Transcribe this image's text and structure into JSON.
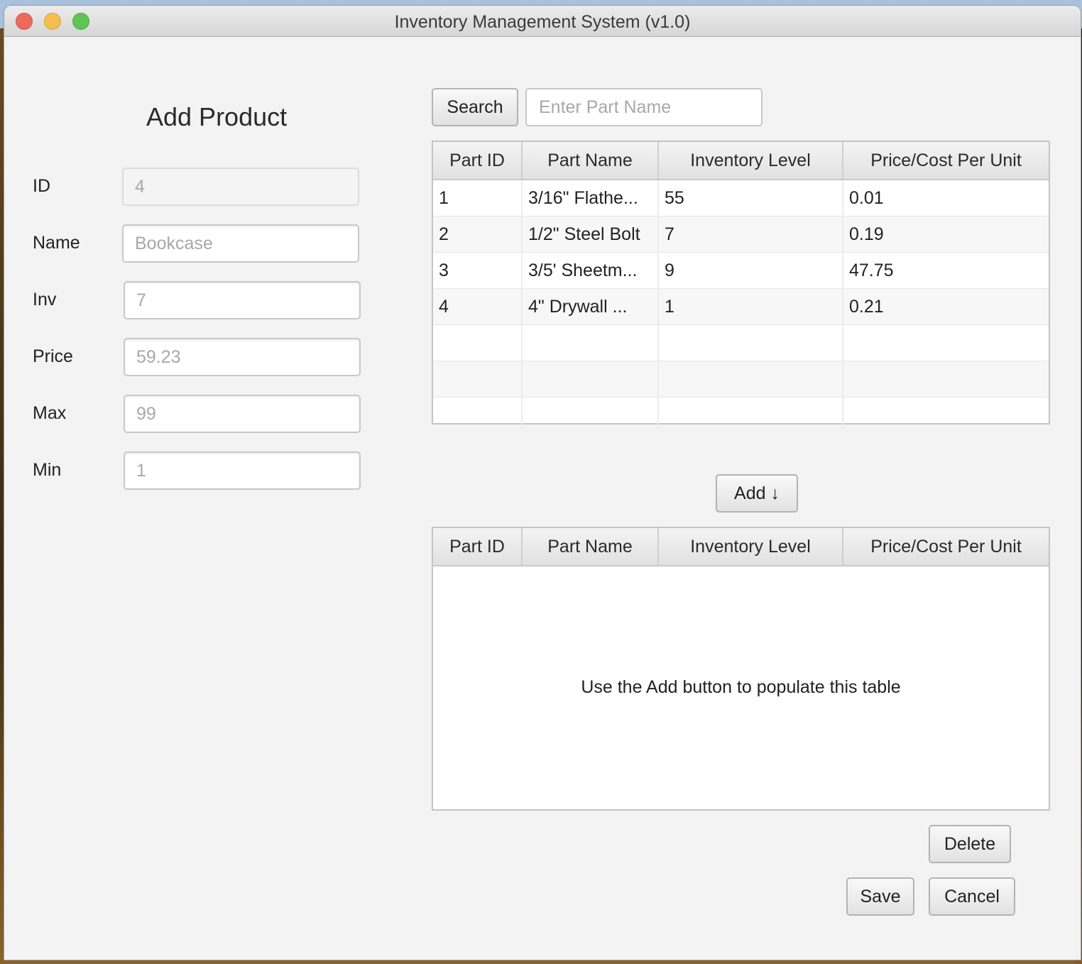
{
  "window": {
    "title": "Inventory Management System (v1.0)",
    "controls": [
      "close",
      "minimize",
      "maximize"
    ]
  },
  "form": {
    "heading": "Add Product",
    "fields": [
      {
        "label": "ID",
        "value": "4",
        "disabled": true
      },
      {
        "label": "Name",
        "value": "Bookcase",
        "disabled": false
      },
      {
        "label": "Inv",
        "value": "7",
        "disabled": false
      },
      {
        "label": "Price",
        "value": "59.23",
        "disabled": false
      },
      {
        "label": "Max",
        "value": "99",
        "disabled": false
      },
      {
        "label": "Min",
        "value": "1",
        "disabled": false
      }
    ]
  },
  "search": {
    "button_label": "Search",
    "placeholder": "Enter Part Name"
  },
  "parts_table": {
    "columns": [
      "Part ID",
      "Part Name",
      "Inventory Level",
      "Price/Cost Per Unit"
    ],
    "rows": [
      [
        "1",
        "3/16\" Flathe...",
        "55",
        "0.01"
      ],
      [
        "2",
        "1/2\" Steel Bolt",
        "7",
        "0.19"
      ],
      [
        "3",
        "3/5' Sheetm...",
        "9",
        "47.75"
      ],
      [
        "4",
        "4\" Drywall ...",
        "1",
        "0.21"
      ]
    ]
  },
  "add_button_label": "Add ↓",
  "associated_table": {
    "columns": [
      "Part ID",
      "Part Name",
      "Inventory Level",
      "Price/Cost Per Unit"
    ],
    "empty_message": "Use the Add button to populate this table"
  },
  "actions": {
    "delete_label": "Delete",
    "save_label": "Save",
    "cancel_label": "Cancel"
  }
}
